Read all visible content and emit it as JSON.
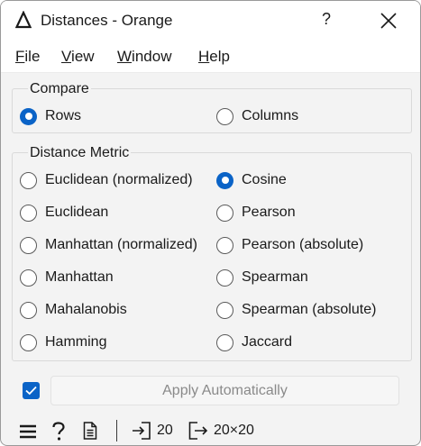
{
  "window": {
    "title": "Distances - Orange",
    "help_glyph": "?",
    "app_icon": "delta-icon",
    "close_icon": "close-icon"
  },
  "menu": {
    "items": [
      {
        "first": "F",
        "rest": "ile"
      },
      {
        "first": "V",
        "rest": "iew"
      },
      {
        "first": "W",
        "rest": "indow"
      },
      {
        "first": "H",
        "rest": "elp"
      }
    ]
  },
  "compare": {
    "title": "Compare",
    "options": [
      {
        "label": "Rows",
        "checked": true
      },
      {
        "label": "Columns",
        "checked": false
      }
    ]
  },
  "metric": {
    "title": "Distance Metric",
    "left": [
      {
        "label": "Euclidean (normalized)",
        "checked": false
      },
      {
        "label": "Euclidean",
        "checked": false
      },
      {
        "label": "Manhattan (normalized)",
        "checked": false
      },
      {
        "label": "Manhattan",
        "checked": false
      },
      {
        "label": "Mahalanobis",
        "checked": false
      },
      {
        "label": "Hamming",
        "checked": false
      }
    ],
    "right": [
      {
        "label": "Cosine",
        "checked": true
      },
      {
        "label": "Pearson",
        "checked": false
      },
      {
        "label": "Pearson (absolute)",
        "checked": false
      },
      {
        "label": "Spearman",
        "checked": false
      },
      {
        "label": "Spearman (absolute)",
        "checked": false
      },
      {
        "label": "Jaccard",
        "checked": false
      }
    ]
  },
  "apply": {
    "checked": true,
    "label": "Apply Automatically"
  },
  "status": {
    "input_count": "20",
    "output_size": "20×20",
    "icons": [
      "menu-icon",
      "help-icon",
      "report-icon",
      "input-icon",
      "output-icon"
    ]
  },
  "colors": {
    "accent": "#0a63c7",
    "window_bg": "#f3f3f3",
    "disabled_text": "#8a8a8a"
  }
}
